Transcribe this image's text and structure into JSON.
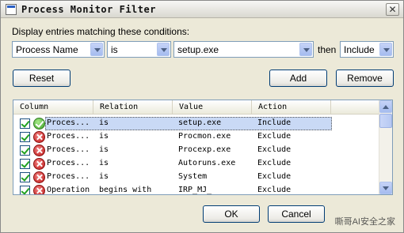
{
  "window": {
    "title": "Process Monitor Filter",
    "close_symbol": "✕"
  },
  "conditions": {
    "label": "Display entries matching these conditions:",
    "column": "Process Name",
    "relation": "is",
    "value": "setup.exe",
    "then_label": "then",
    "action": "Include"
  },
  "buttons": {
    "reset": "Reset",
    "add": "Add",
    "remove": "Remove",
    "ok": "OK",
    "cancel": "Cancel"
  },
  "list": {
    "headers": [
      "Column",
      "Relation",
      "Value",
      "Action"
    ],
    "rows": [
      {
        "column": "Proces...",
        "relation": "is",
        "value": "setup.exe",
        "action": "Include",
        "checked": true,
        "icon": "include-icon",
        "selected": true
      },
      {
        "column": "Proces...",
        "relation": "is",
        "value": "Procmon.exe",
        "action": "Exclude",
        "checked": true,
        "icon": "exclude-icon",
        "selected": false
      },
      {
        "column": "Proces...",
        "relation": "is",
        "value": "Procexp.exe",
        "action": "Exclude",
        "checked": true,
        "icon": "exclude-icon",
        "selected": false
      },
      {
        "column": "Proces...",
        "relation": "is",
        "value": "Autoruns.exe",
        "action": "Exclude",
        "checked": true,
        "icon": "exclude-icon",
        "selected": false
      },
      {
        "column": "Proces...",
        "relation": "is",
        "value": "System",
        "action": "Exclude",
        "checked": true,
        "icon": "exclude-icon",
        "selected": false
      },
      {
        "column": "Operation",
        "relation": "begins with",
        "value": "IRP_MJ_",
        "action": "Exclude",
        "checked": true,
        "icon": "exclude-icon",
        "selected": false
      }
    ]
  },
  "watermark": "嘶哥AI安全之家"
}
